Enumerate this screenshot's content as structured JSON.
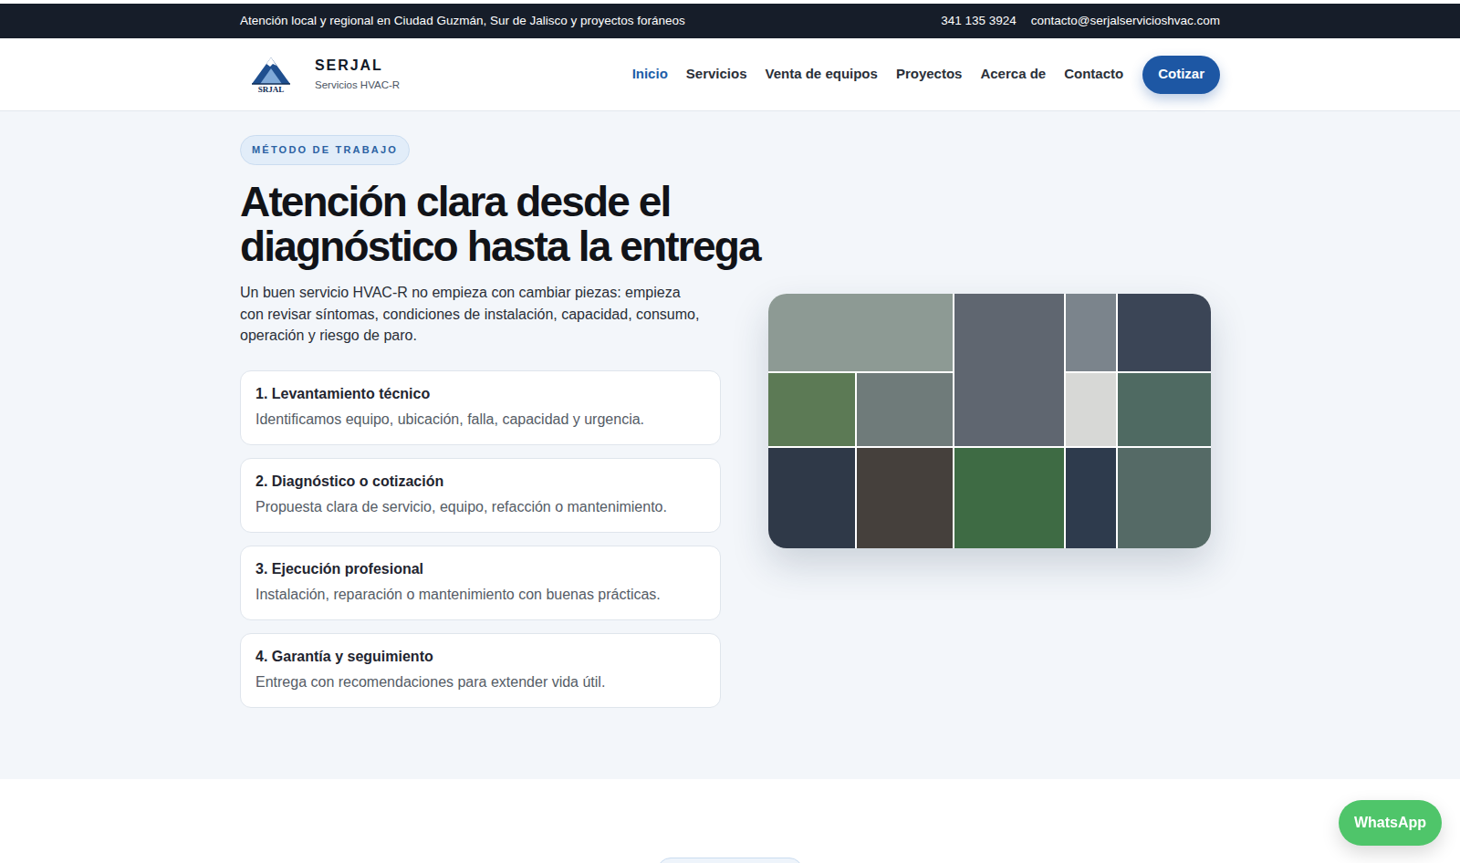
{
  "topbar": {
    "message": "Atención local y regional en Ciudad Guzmán, Sur de Jalisco y proyectos foráneos",
    "phone": "341 135 3924",
    "email": "contacto@serjalservicioshvac.com"
  },
  "brand": {
    "logo_text": "SRJAL",
    "name": "SERJAL",
    "tagline": "Servicios HVAC-R"
  },
  "nav": [
    {
      "label": "Inicio",
      "selected": true
    },
    {
      "label": "Servicios",
      "selected": false
    },
    {
      "label": "Venta de equipos",
      "selected": false
    },
    {
      "label": "Proyectos",
      "selected": false
    },
    {
      "label": "Acerca de",
      "selected": false
    },
    {
      "label": "Contacto",
      "selected": false
    }
  ],
  "cta": "Cotizar",
  "section": {
    "badge": "MÉTODO DE TRABAJO",
    "title": "Atención clara desde el diagnóstico hasta la entrega",
    "intro": "Un buen servicio HVAC-R no empieza con cambiar piezas: empieza con revisar síntomas, condiciones de instalación, capacidad, consumo, operación y riesgo de paro.",
    "steps": [
      {
        "title": "1. Levantamiento técnico",
        "description": "Identificamos equipo, ubicación, falla, capacidad y urgencia."
      },
      {
        "title": "2. Diagnóstico o cotización",
        "description": "Propuesta clara de servicio, equipo, refacción o mantenimiento."
      },
      {
        "title": "3. Ejecución profesional",
        "description": "Instalación, reparación o mantenimiento con buenas prácticas."
      },
      {
        "title": "4. Garantía y seguimiento",
        "description": "Entrega con recomendaciones para extender vida útil."
      }
    ]
  },
  "whatsapp": "WhatsApp"
}
